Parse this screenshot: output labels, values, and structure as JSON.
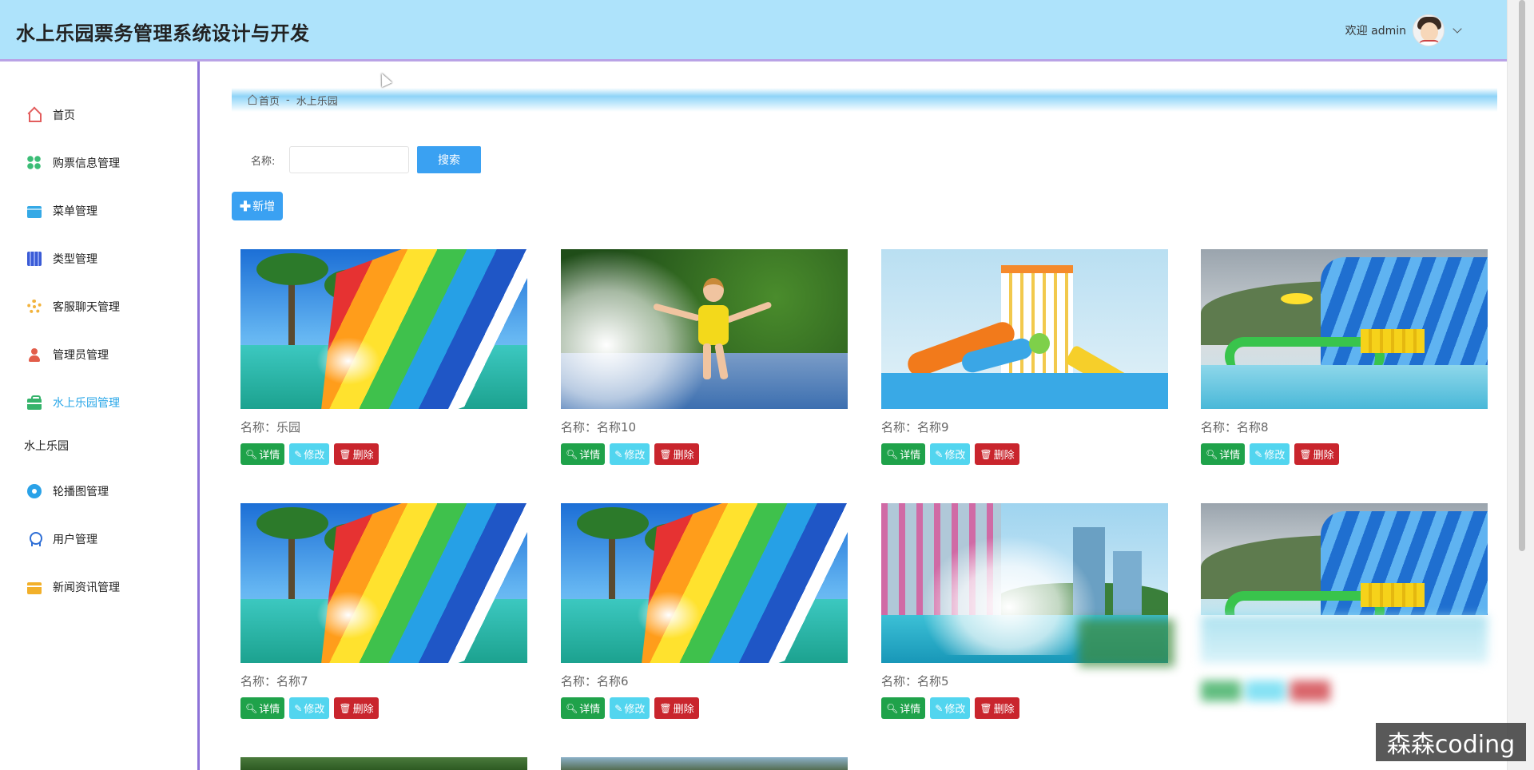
{
  "header": {
    "title": "水上乐园票务管理系统设计与开发",
    "welcome": "欢迎 admin"
  },
  "sidebar": {
    "items": [
      {
        "label": "首页",
        "icon": "home-icon"
      },
      {
        "label": "购票信息管理",
        "icon": "grid-icon"
      },
      {
        "label": "菜单管理",
        "icon": "card-icon"
      },
      {
        "label": "类型管理",
        "icon": "type-icon"
      },
      {
        "label": "客服聊天管理",
        "icon": "gear-icon"
      },
      {
        "label": "管理员管理",
        "icon": "user-icon"
      },
      {
        "label": "水上乐园管理",
        "icon": "briefcase-icon"
      }
    ],
    "group_label": "水上乐园",
    "group_items": [
      {
        "label": "轮播图管理",
        "icon": "carousel-icon"
      },
      {
        "label": "用户管理",
        "icon": "medal-icon"
      },
      {
        "label": "新闻资讯管理",
        "icon": "news-icon"
      }
    ]
  },
  "breadcrumb": {
    "home": "首页",
    "separator": "-",
    "current": "水上乐园"
  },
  "search": {
    "label": "名称:",
    "value": "",
    "placeholder": "",
    "button": "搜索"
  },
  "add_button": "新增",
  "cards": [
    {
      "name": "名称：乐园"
    },
    {
      "name": "名称：名称10"
    },
    {
      "name": "名称：名称9"
    },
    {
      "name": "名称：名称8"
    },
    {
      "name": "名称：名称7"
    },
    {
      "name": "名称：名称6"
    },
    {
      "name": "名称：名称5"
    }
  ],
  "card_actions": {
    "detail": "详情",
    "edit": "修改",
    "delete": "删除"
  },
  "watermark": "森森coding",
  "colors": {
    "header_bg": "#aee3fb",
    "accent": "#3aa1f2",
    "detail": "#1fa24a",
    "edit": "#52d5ef",
    "delete": "#c9252d",
    "sidebar_border": "#8e73d8",
    "active_menu": "#2aa7e8"
  }
}
